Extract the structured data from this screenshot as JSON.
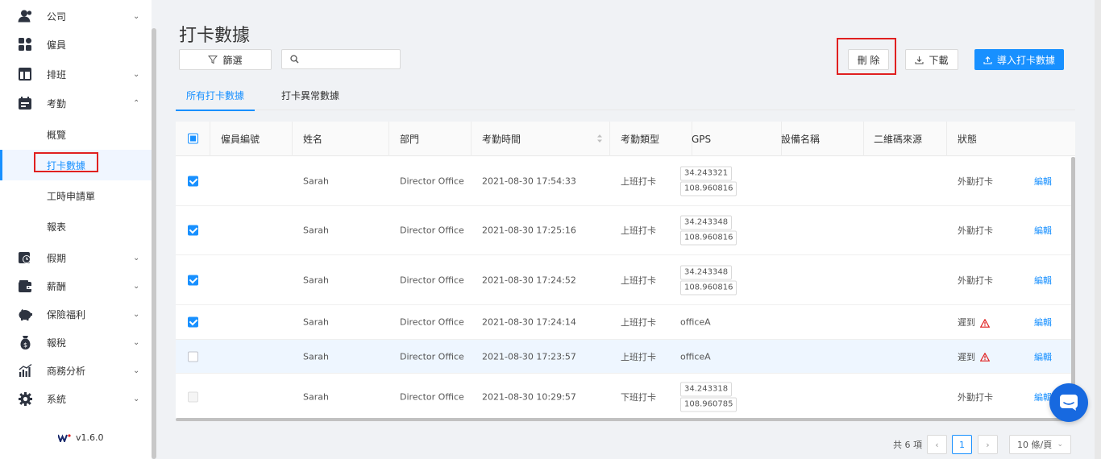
{
  "sidebar": {
    "items": [
      {
        "label": "公司",
        "icon": "user-icon",
        "has_chevron": true,
        "chevron": "⌄"
      },
      {
        "label": "僱員",
        "icon": "grid-icon",
        "has_chevron": false
      },
      {
        "label": "排班",
        "icon": "calendar-layout-icon",
        "has_chevron": true,
        "chevron": "⌄"
      },
      {
        "label": "考勤",
        "icon": "calendar-icon",
        "has_chevron": true,
        "chevron": "⌃"
      },
      {
        "label": "假期",
        "icon": "clock-calendar-icon",
        "has_chevron": true,
        "chevron": "⌄"
      },
      {
        "label": "薪酬",
        "icon": "wallet-icon",
        "has_chevron": true,
        "chevron": "⌄"
      },
      {
        "label": "保險福利",
        "icon": "piggy-bank-icon",
        "has_chevron": true,
        "chevron": "⌄"
      },
      {
        "label": "報稅",
        "icon": "money-bag-icon",
        "has_chevron": true,
        "chevron": "⌄"
      },
      {
        "label": "商務分析",
        "icon": "bar-chart-icon",
        "has_chevron": true,
        "chevron": "⌄"
      },
      {
        "label": "系統",
        "icon": "gear-icon",
        "has_chevron": true,
        "chevron": "⌄"
      }
    ],
    "sub_items": [
      "概覽",
      "打卡數據",
      "工時申請單",
      "報表"
    ],
    "active_sub": "打卡數據",
    "version": "v1.6.0"
  },
  "page": {
    "title": "打卡數據"
  },
  "toolbar": {
    "filter_label": "篩選",
    "search_placeholder": "",
    "delete_label": "刪 除",
    "download_label": "下載",
    "import_label": "導入打卡數據"
  },
  "tabs": [
    {
      "label": "所有打卡數據",
      "active": true
    },
    {
      "label": "打卡異常數據",
      "active": false
    }
  ],
  "table": {
    "columns": [
      "僱員編號",
      "姓名",
      "部門",
      "考勤時間",
      "考勤類型",
      "GPS",
      "設備名稱",
      "二維碼來源",
      "狀態"
    ],
    "edit_label": "編輯",
    "rows": [
      {
        "checked": true,
        "emp_no": "",
        "name": "Sarah",
        "dept": "Director Office",
        "time": "2021-08-30 17:54:33",
        "type": "上班打卡",
        "gps": [
          "34.243321",
          "108.960816"
        ],
        "device": "",
        "qr": "",
        "status": "外勤打卡",
        "warn": false
      },
      {
        "checked": true,
        "emp_no": "",
        "name": "Sarah",
        "dept": "Director Office",
        "time": "2021-08-30 17:25:16",
        "type": "上班打卡",
        "gps": [
          "34.243348",
          "108.960816"
        ],
        "device": "",
        "qr": "",
        "status": "外勤打卡",
        "warn": false
      },
      {
        "checked": true,
        "emp_no": "",
        "name": "Sarah",
        "dept": "Director Office",
        "time": "2021-08-30 17:24:52",
        "type": "上班打卡",
        "gps": [
          "34.243348",
          "108.960816"
        ],
        "device": "",
        "qr": "",
        "status": "外勤打卡",
        "warn": false
      },
      {
        "checked": true,
        "emp_no": "",
        "name": "Sarah",
        "dept": "Director Office",
        "time": "2021-08-30 17:24:14",
        "type": "上班打卡",
        "gps_text": "officeA",
        "device": "",
        "qr": "",
        "status": "遲到",
        "warn": true
      },
      {
        "checked": false,
        "emp_no": "",
        "name": "Sarah",
        "dept": "Director Office",
        "time": "2021-08-30 17:23:57",
        "type": "上班打卡",
        "gps_text": "officeA",
        "device": "",
        "qr": "",
        "status": "遲到",
        "warn": true
      },
      {
        "checked": false,
        "disabled": true,
        "emp_no": "",
        "name": "Sarah",
        "dept": "Director Office",
        "time": "2021-08-30 10:29:57",
        "type": "下班打卡",
        "gps": [
          "34.243318",
          "108.960785"
        ],
        "device": "",
        "qr": "",
        "status": "外勤打卡",
        "warn": false
      }
    ]
  },
  "pagination": {
    "total_text": "共 6 項",
    "prev": "‹",
    "next": "›",
    "current_page": "1",
    "page_size": "10 條/頁",
    "size_chevron": "⌄"
  },
  "colors": {
    "primary": "#1890ff",
    "highlight": "#e02020",
    "warn": "#e02020"
  }
}
